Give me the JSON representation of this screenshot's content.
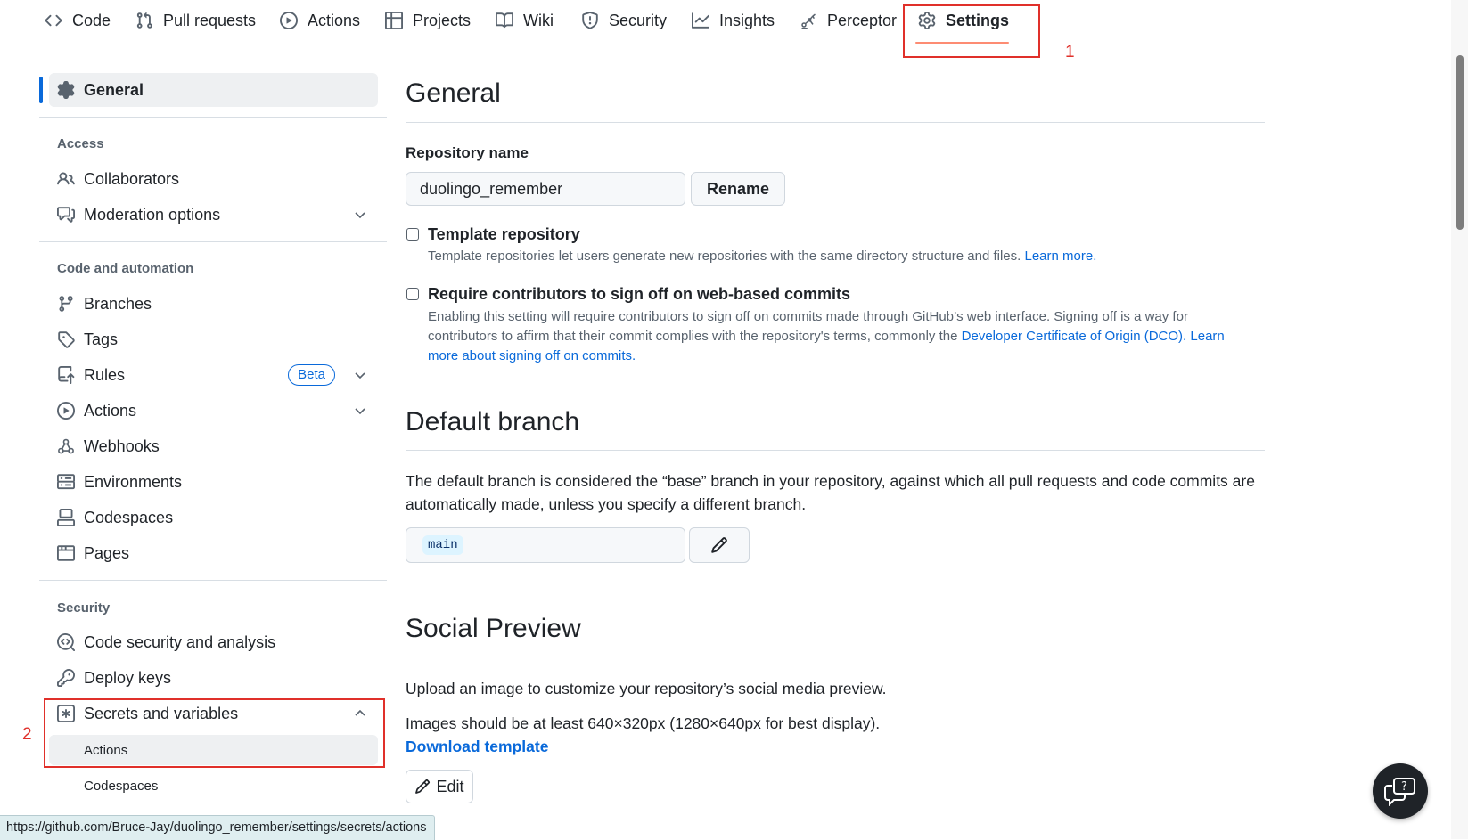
{
  "nav": {
    "tabs": [
      {
        "label": "Code",
        "icon": "code-icon"
      },
      {
        "label": "Pull requests",
        "icon": "git-pull-request-icon"
      },
      {
        "label": "Actions",
        "icon": "play-circle-icon"
      },
      {
        "label": "Projects",
        "icon": "table-icon"
      },
      {
        "label": "Wiki",
        "icon": "book-icon"
      },
      {
        "label": "Security",
        "icon": "shield-icon"
      },
      {
        "label": "Insights",
        "icon": "graph-icon"
      },
      {
        "label": "Perceptor",
        "icon": "robot-arm-icon"
      },
      {
        "label": "Settings",
        "icon": "gear-icon"
      }
    ],
    "active_tab": "Settings"
  },
  "annotations": {
    "step1": "1",
    "step2": "2",
    "color": "#e0302a"
  },
  "sidebar": {
    "general": "General",
    "access_heading": "Access",
    "collaborators": "Collaborators",
    "moderation": "Moderation options",
    "code_heading": "Code and automation",
    "branches": "Branches",
    "tags": "Tags",
    "rules": "Rules",
    "rules_badge": "Beta",
    "actions": "Actions",
    "webhooks": "Webhooks",
    "environments": "Environments",
    "codespaces": "Codespaces",
    "pages": "Pages",
    "security_heading": "Security",
    "code_security": "Code security and analysis",
    "deploy_keys": "Deploy keys",
    "secrets": "Secrets and variables",
    "secrets_sub_actions": "Actions",
    "secrets_sub_codespaces": "Codespaces"
  },
  "main": {
    "general_title": "General",
    "repo_name_label": "Repository name",
    "repo_name_value": "duolingo_remember",
    "rename_button": "Rename",
    "template_label": "Template repository",
    "template_note": "Template repositories let users generate new repositories with the same directory structure and files.",
    "learn_more": "Learn more.",
    "signoff_label": "Require contributors to sign off on web-based commits",
    "signoff_note_1": "Enabling this setting will require contributors to sign off on commits made through GitHub’s web interface. Signing off is a way for contributors to affirm that their commit complies with the repository's terms, commonly the",
    "signoff_link_dco": "Developer Certificate of Origin (DCO).",
    "signoff_link_learn": "Learn more about signing off on commits.",
    "default_branch_title": "Default branch",
    "default_branch_desc": "The default branch is considered the “base” branch in your repository, against which all pull requests and code commits are automatically made, unless you specify a different branch.",
    "default_branch_value": "main",
    "social_title": "Social Preview",
    "social_desc": "Upload an image to customize your repository’s social media preview.",
    "social_size": "Images should be at least 640×320px (1280×640px for best display).",
    "download_template": "Download template",
    "edit_button": "Edit"
  },
  "statusbar": {
    "url": "https://github.com/Bruce-Jay/duolingo_remember/settings/secrets/actions"
  },
  "colors": {
    "accent": "#0969da",
    "tab_underline": "#fd8c73",
    "annotation": "#e0302a"
  }
}
